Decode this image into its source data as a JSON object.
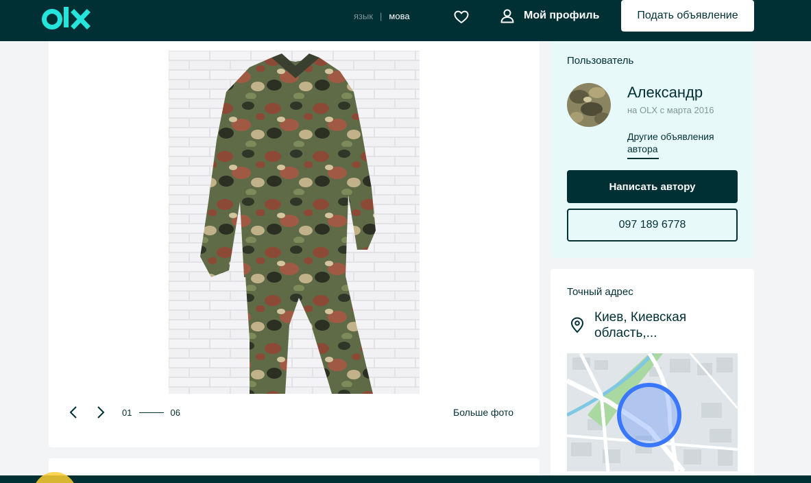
{
  "header": {
    "logo_text": "olx",
    "lang_inactive": "язык",
    "lang_separator": "|",
    "lang_active": "мова",
    "profile_label": "Мой профиль",
    "post_button": "Подать объявление",
    "icons": {
      "favorites": "heart-icon",
      "profile": "user-icon"
    }
  },
  "gallery": {
    "current": "01",
    "total": "06",
    "big_photos": "Больше фото",
    "icons": {
      "prev": "chevron-left-icon",
      "next": "chevron-right-icon"
    }
  },
  "user": {
    "section_title": "Пользователь",
    "name": "Александр",
    "since": "на OLX с марта 2016",
    "other_ads": "Другие объявления автора",
    "write_button": "Написать автору",
    "phone": "097 189 6778"
  },
  "address": {
    "section_title": "Точный адрес",
    "location": "Киев, Киевская область,...",
    "icons": {
      "pin": "map-pin-icon"
    }
  },
  "colors": {
    "brand_dark": "#002f34",
    "accent_teal": "#23e5db",
    "user_card_bg": "#e8f9f9",
    "map_circle": "#3a77ff"
  }
}
